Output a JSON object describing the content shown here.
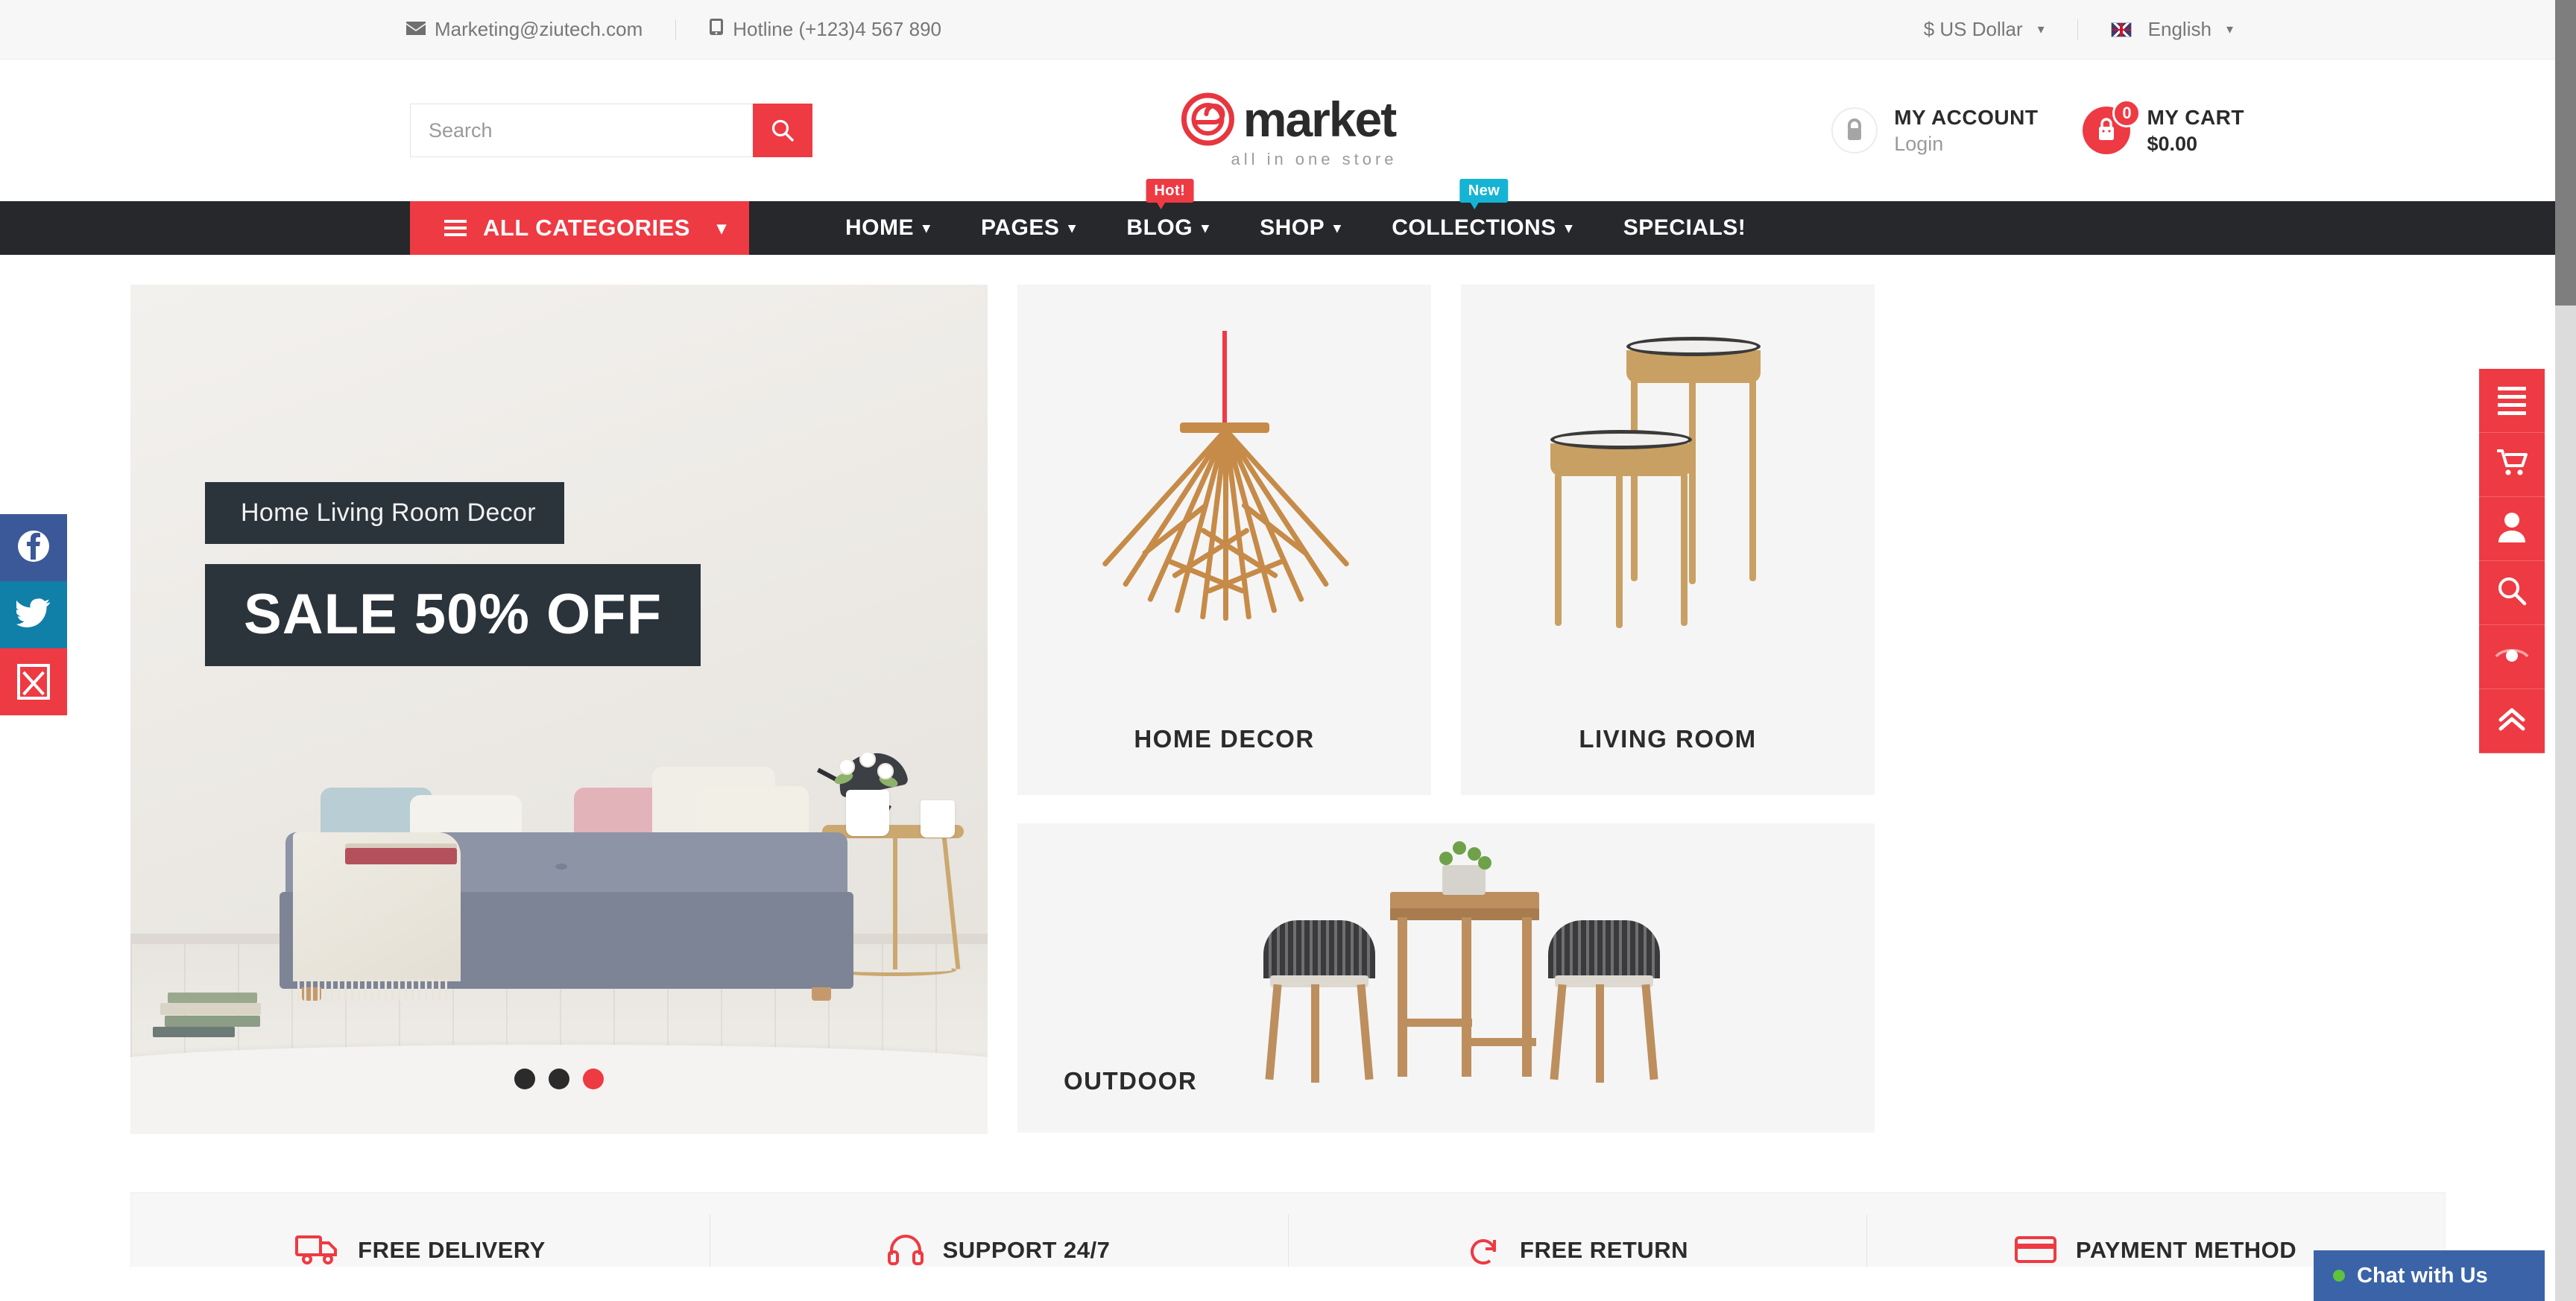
{
  "topbar": {
    "email": "Marketing@ziutech.com",
    "email_icon": "envelope-icon",
    "hotline": "Hotline (+123)4 567 890",
    "hotline_icon": "phone-icon",
    "currency": "$ US Dollar",
    "language": "English",
    "caret": "▾"
  },
  "header": {
    "search_placeholder": "Search",
    "search_value": "",
    "logo_text": "market",
    "logo_tagline": "all in one store",
    "account_title": "MY ACCOUNT",
    "account_sub": "Login",
    "cart_title": "MY CART",
    "cart_total": "$0.00",
    "cart_count": "0"
  },
  "nav": {
    "all_categories": "ALL CATEGORIES",
    "items": [
      {
        "label": "HOME",
        "caret": "▾",
        "badge": null
      },
      {
        "label": "PAGES",
        "caret": "▾",
        "badge": null
      },
      {
        "label": "BLOG",
        "caret": "▾",
        "badge": "Hot!"
      },
      {
        "label": "SHOP",
        "caret": "▾",
        "badge": null
      },
      {
        "label": "COLLECTIONS",
        "caret": "▾",
        "badge": "New"
      },
      {
        "label": "SPECIALS!",
        "caret": "",
        "badge": null
      }
    ]
  },
  "hero": {
    "caption": "Home Living Room Decor",
    "headline": "SALE 50% OFF",
    "slide_count": 3,
    "active_slide": 3
  },
  "categories": [
    {
      "label": "HOME DECOR"
    },
    {
      "label": "LIVING ROOM"
    },
    {
      "label": "OUTDOOR"
    }
  ],
  "features": [
    {
      "label": "FREE DELIVERY",
      "icon": "truck-icon"
    },
    {
      "label": "SUPPORT 24/7",
      "icon": "headphone-icon"
    },
    {
      "label": "FREE RETURN",
      "icon": "return-arrow-icon"
    },
    {
      "label": "PAYMENT METHOD",
      "icon": "credit-card-icon"
    }
  ],
  "social": [
    {
      "name": "facebook",
      "color": "#3b5998"
    },
    {
      "name": "twitter",
      "color": "#1080a8"
    },
    {
      "name": "broken",
      "color": "#ee3a43"
    }
  ],
  "rightrail": [
    {
      "icon": "menu-icon"
    },
    {
      "icon": "cart-icon"
    },
    {
      "icon": "user-icon"
    },
    {
      "icon": "search-icon"
    },
    {
      "icon": "eye-icon"
    },
    {
      "icon": "scroll-top-icon"
    }
  ],
  "chat": {
    "label": "Chat with Us",
    "status_color": "#5ec23d"
  },
  "colors": {
    "accent": "#ee3a43",
    "nav_bg": "#26282b",
    "badge_new": "#15b4d4",
    "chat_bg": "#3b63a8"
  }
}
